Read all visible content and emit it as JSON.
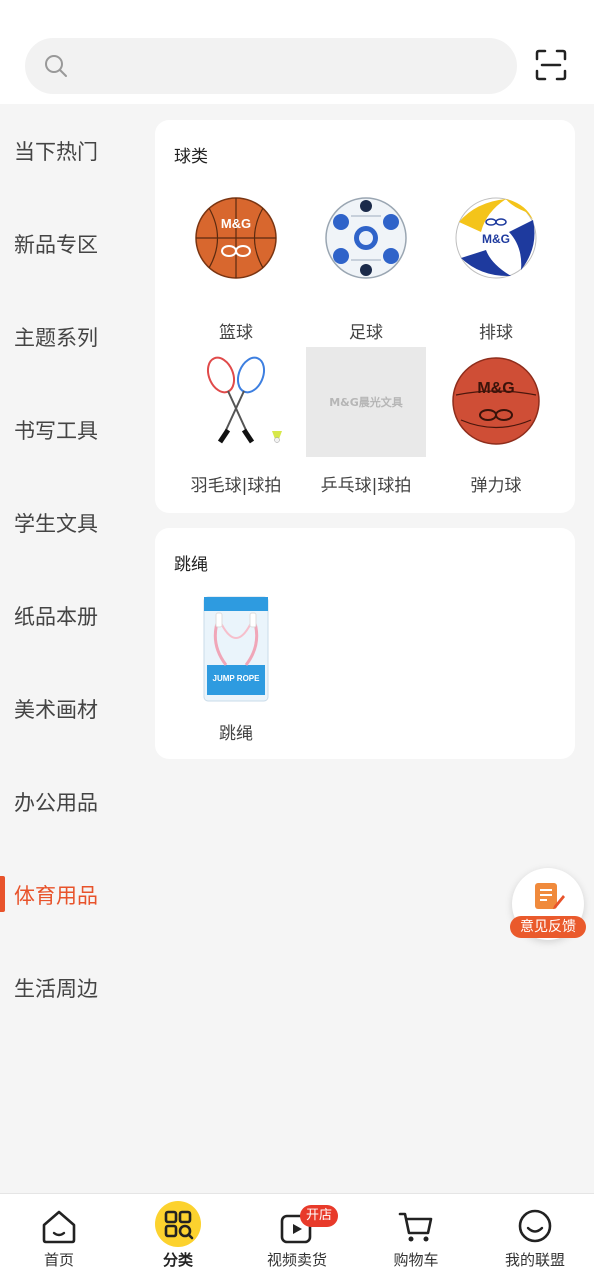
{
  "search": {
    "placeholder": "",
    "value": ""
  },
  "icons": {
    "search": "search-icon",
    "scan": "scan-icon"
  },
  "accent_color": "#e8532b",
  "sidebar": {
    "items": [
      {
        "label": "当下热门",
        "active": false
      },
      {
        "label": "新品专区",
        "active": false
      },
      {
        "label": "主题系列",
        "active": false
      },
      {
        "label": "书写工具",
        "active": false
      },
      {
        "label": "学生文具",
        "active": false
      },
      {
        "label": "纸品本册",
        "active": false
      },
      {
        "label": "美术画材",
        "active": false
      },
      {
        "label": "办公用品",
        "active": false
      },
      {
        "label": "体育用品",
        "active": true
      },
      {
        "label": "生活周边",
        "active": false
      }
    ]
  },
  "sections": [
    {
      "title": "球类",
      "items": [
        {
          "label": "篮球",
          "image": "basketball"
        },
        {
          "label": "足球",
          "image": "football"
        },
        {
          "label": "排球",
          "image": "volleyball"
        },
        {
          "label": "羽毛球|球拍",
          "image": "badminton-rackets"
        },
        {
          "label": "乒乓球|球拍",
          "image": "placeholder",
          "placeholder_text": "M&G晨光文具"
        },
        {
          "label": "弹力球",
          "image": "bouncy-ball"
        }
      ]
    },
    {
      "title": "跳绳",
      "items": [
        {
          "label": "跳绳",
          "image": "jump-rope"
        }
      ]
    }
  ],
  "product_print": {
    "brand": "M&G",
    "rope_pack": "JUMP ROPE"
  },
  "feedback": {
    "label": "意见反馈",
    "icon": "feedback-icon"
  },
  "tabbar": {
    "tabs": [
      {
        "label": "首页",
        "icon": "home-icon"
      },
      {
        "label": "分类",
        "icon": "category-icon",
        "active": true
      },
      {
        "label": "视频卖货",
        "icon": "video-icon",
        "badge": "开店"
      },
      {
        "label": "购物车",
        "icon": "cart-icon"
      },
      {
        "label": "我的联盟",
        "icon": "smile-icon"
      }
    ]
  }
}
